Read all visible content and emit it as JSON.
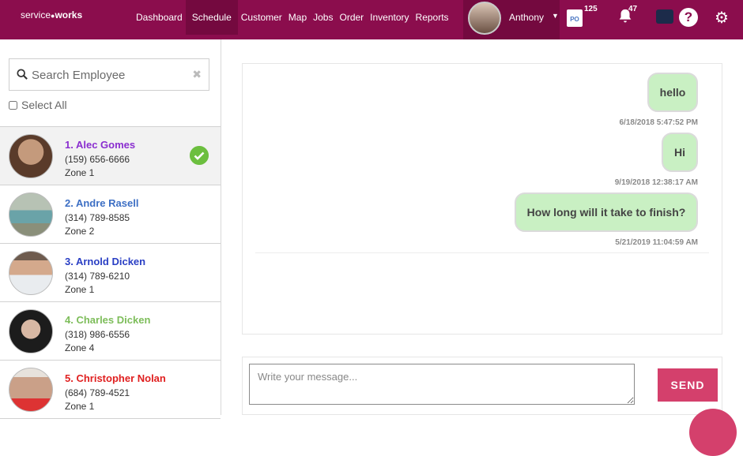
{
  "header": {
    "logo_text": "service",
    "logo_bold": "works",
    "nav": [
      "Dashboard",
      "Schedule",
      "Customer",
      "Map",
      "Jobs",
      "Order",
      "Inventory",
      "Reports"
    ],
    "active_nav": "Schedule",
    "user_name": "Anthony",
    "po_badge": "125",
    "notification_badge": "47",
    "po_icon_text": "PO"
  },
  "search": {
    "placeholder": "Search Employee",
    "select_all_label": "Select All"
  },
  "employees": [
    {
      "name": "1. Alec Gomes",
      "phone": "(159) 656-6666",
      "zone": "Zone 1",
      "color": "#8a2ecf",
      "selected": true
    },
    {
      "name": "2. Andre Rasell",
      "phone": "(314) 789-8585",
      "zone": "Zone 2",
      "color": "#3d6fc4",
      "selected": false
    },
    {
      "name": "3. Arnold Dicken",
      "phone": "(314) 789-6210",
      "zone": "Zone 1",
      "color": "#2a3fc4",
      "selected": false
    },
    {
      "name": "4. Charles Dicken",
      "phone": "(318) 986-6556",
      "zone": "Zone 4",
      "color": "#7dbd5a",
      "selected": false
    },
    {
      "name": "5. Christopher Nolan",
      "phone": "(684) 789-4521",
      "zone": "Zone 1",
      "color": "#e02020",
      "selected": false
    }
  ],
  "messages": [
    {
      "text": "hello",
      "timestamp": "6/18/2018 5:47:52 PM"
    },
    {
      "text": "Hi",
      "timestamp": "9/19/2018 12:38:17 AM"
    },
    {
      "text": "How long will it take to finish?",
      "timestamp": "5/21/2019 11:04:59 AM"
    }
  ],
  "compose": {
    "placeholder": "Write your message...",
    "send_label": "SEND"
  },
  "colors": {
    "brand": "#8b0d4d",
    "bubble": "#c9f0c3",
    "send": "#d4406c"
  }
}
